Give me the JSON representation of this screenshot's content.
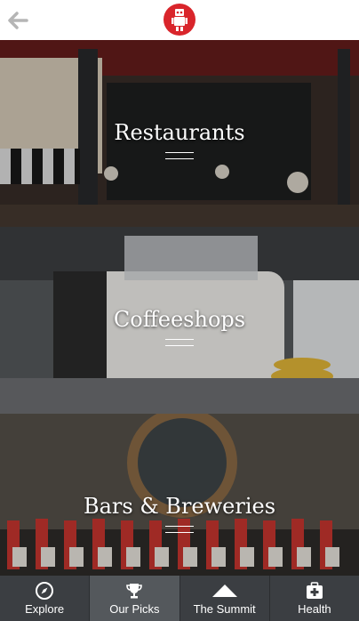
{
  "tiles": [
    {
      "label": "Restaurants"
    },
    {
      "label": "Coffeeshops"
    },
    {
      "label": "Bars & Breweries"
    }
  ],
  "tabs": [
    {
      "label": "Explore",
      "icon": "compass-icon"
    },
    {
      "label": "Our Picks",
      "icon": "trophy-icon"
    },
    {
      "label": "The Summit",
      "icon": "mountain-icon"
    },
    {
      "label": "Health",
      "icon": "medkit-icon"
    }
  ],
  "colors": {
    "brand": "#d9252b",
    "tabbar": "#3b3e42",
    "tab_active": "#54585c"
  }
}
